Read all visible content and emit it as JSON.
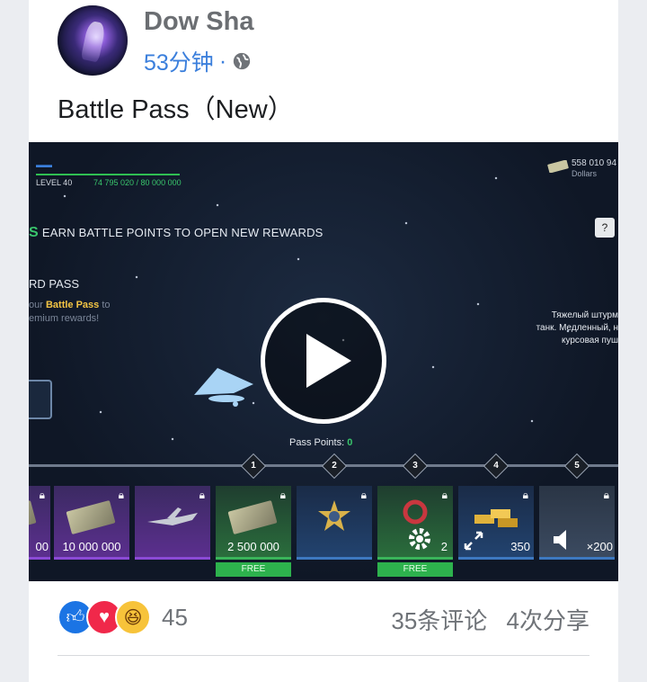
{
  "post": {
    "author": "Dow Sha",
    "time": "53分钟",
    "separator": "·",
    "text": "Battle Pass（New）"
  },
  "video": {
    "level": "LEVEL 40",
    "xp": "74 795 020 / 80 000 000",
    "dollars_amount": "558 010 94",
    "dollars_label": "Dollars",
    "banner_prefix": "S",
    "banner": "EARN BATTLE POINTS TO OPEN NEW REWARDS",
    "help": "?",
    "pass_title": "RD PASS",
    "pass_desc_1": "our",
    "pass_desc_hl": "Battle Pass",
    "pass_desc_2": "to",
    "pass_desc_3": "emium rewards!",
    "ru_line_1": "Тяжелый штурм",
    "ru_line_2": "танк. Медленный, н",
    "ru_line_3": "курсовая пуш",
    "pass_points_label": "Pass Points:",
    "pass_points_value": "0",
    "milestones": [
      "1",
      "2",
      "3",
      "4",
      "5"
    ],
    "tiles": [
      "00",
      "10 000 000",
      "",
      "2 500 000",
      "",
      "2",
      "350",
      "×200"
    ],
    "free_label": "FREE"
  },
  "footer": {
    "reaction_count": "45",
    "comments": "35条评论",
    "shares": "4次分享"
  },
  "colors": {
    "link_blue": "#3b7fdc",
    "like_blue": "#1b74e4",
    "love_red": "#f0284a",
    "haha_yellow": "#f7c33a",
    "game_green": "#39c56c"
  }
}
